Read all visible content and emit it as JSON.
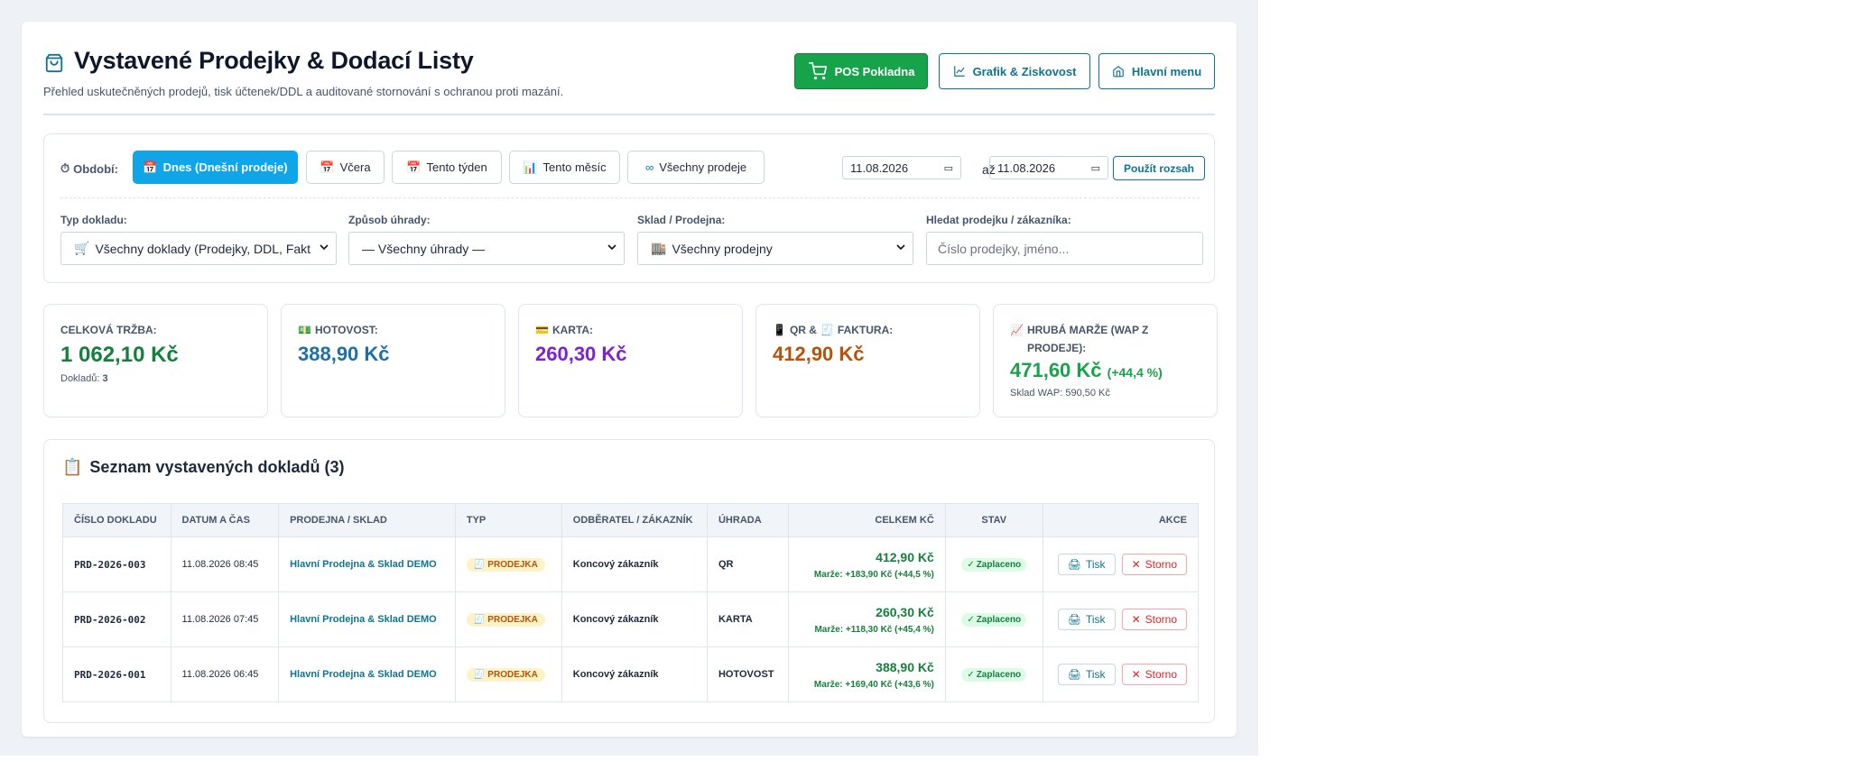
{
  "header": {
    "title": "Vystavené Prodejky & Dodací Listy",
    "subtitle": "Přehled uskutečněných prodejů, tisk účtenek/DDL a auditované stornování s ochranou proti mazání.",
    "buttons": {
      "pos": "POS Pokladna",
      "graf": "Grafik & Ziskovost",
      "menu": "Hlavní menu"
    }
  },
  "filters": {
    "period_label": "Období:",
    "periods": [
      {
        "label": "Dnes (Dnešní prodeje)",
        "active": true
      },
      {
        "label": "Včera",
        "active": false
      },
      {
        "label": "Tento týden",
        "active": false
      },
      {
        "label": "Tento měsíc",
        "active": false
      },
      {
        "label": "Všechny prodeje",
        "active": false
      }
    ],
    "date_from": "11.08.2026",
    "date_sep": "až",
    "date_to": "11.08.2026",
    "apply_label": "Použít rozsah",
    "doc_type_label": "Typ dokladu:",
    "doc_type_value": "Všechny doklady (Prodejky, DDL, Fakt",
    "payment_label": "Způsob úhrady:",
    "payment_value": "— Všechny úhrady —",
    "store_label": "Sklad / Prodejna:",
    "store_value": "Všechny prodejny",
    "search_label": "Hledat prodejku / zákazníka:",
    "search_placeholder": "Číslo prodejky, jméno..."
  },
  "stats": {
    "total": {
      "label": "CELKOVÁ TRŽBA:",
      "value": "1 062,10 Kč",
      "sub_label": "Dokladů:",
      "sub_value": "3"
    },
    "cash": {
      "label": "HOTOVOST:",
      "value": "388,90 Kč"
    },
    "card": {
      "label": "KARTA:",
      "value": "260,30 Kč"
    },
    "qr": {
      "label": "QR &",
      "label2": "FAKTURA:",
      "value": "412,90 Kč"
    },
    "margin": {
      "label": "HRUBÁ MARŽE (WAP Z PRODEJE):",
      "value": "471,60 Kč",
      "pct": "(+44,4 %)",
      "sub": "Sklad WAP: 590,50 Kč"
    }
  },
  "table": {
    "title": "Seznam vystavených dokladů (3)",
    "columns": [
      "ČÍSLO DOKLADU",
      "DATUM A ČAS",
      "PRODEJNA / SKLAD",
      "TYP",
      "ODBĚRATEL / ZÁKAZNÍK",
      "ÚHRADA",
      "CELKEM KČ",
      "STAV",
      "AKCE"
    ],
    "rows": [
      {
        "id": "PRD-2026-003",
        "datetime": "11.08.2026 08:45",
        "store": "Hlavní Prodejna & Sklad DEMO",
        "type": "PRODEJKA",
        "customer": "Koncový zákazník",
        "payment": "QR",
        "total": "412,90 Kč",
        "margin": "Marže: +183,90 Kč (+44,5 %)",
        "status": "Zaplaceno"
      },
      {
        "id": "PRD-2026-002",
        "datetime": "11.08.2026 07:45",
        "store": "Hlavní Prodejna & Sklad DEMO",
        "type": "PRODEJKA",
        "customer": "Koncový zákazník",
        "payment": "KARTA",
        "total": "260,30 Kč",
        "margin": "Marže: +118,30 Kč (+45,4 %)",
        "status": "Zaplaceno"
      },
      {
        "id": "PRD-2026-001",
        "datetime": "11.08.2026 06:45",
        "store": "Hlavní Prodejna & Sklad DEMO",
        "type": "PRODEJKA",
        "customer": "Koncový zákazník",
        "payment": "HOTOVOST",
        "total": "388,90 Kč",
        "margin": "Marže: +169,40 Kč (+43,6 %)",
        "status": "Zaplaceno"
      }
    ],
    "action_print": "Tisk",
    "action_cancel": "Storno"
  },
  "colors": {
    "primary": "#0ea5e9",
    "success": "#16a34a",
    "teal": "#0e7490",
    "cash": "#1e6fa3",
    "card": "#7e22ce",
    "qr": "#b45309",
    "danger": "#dc2626"
  }
}
